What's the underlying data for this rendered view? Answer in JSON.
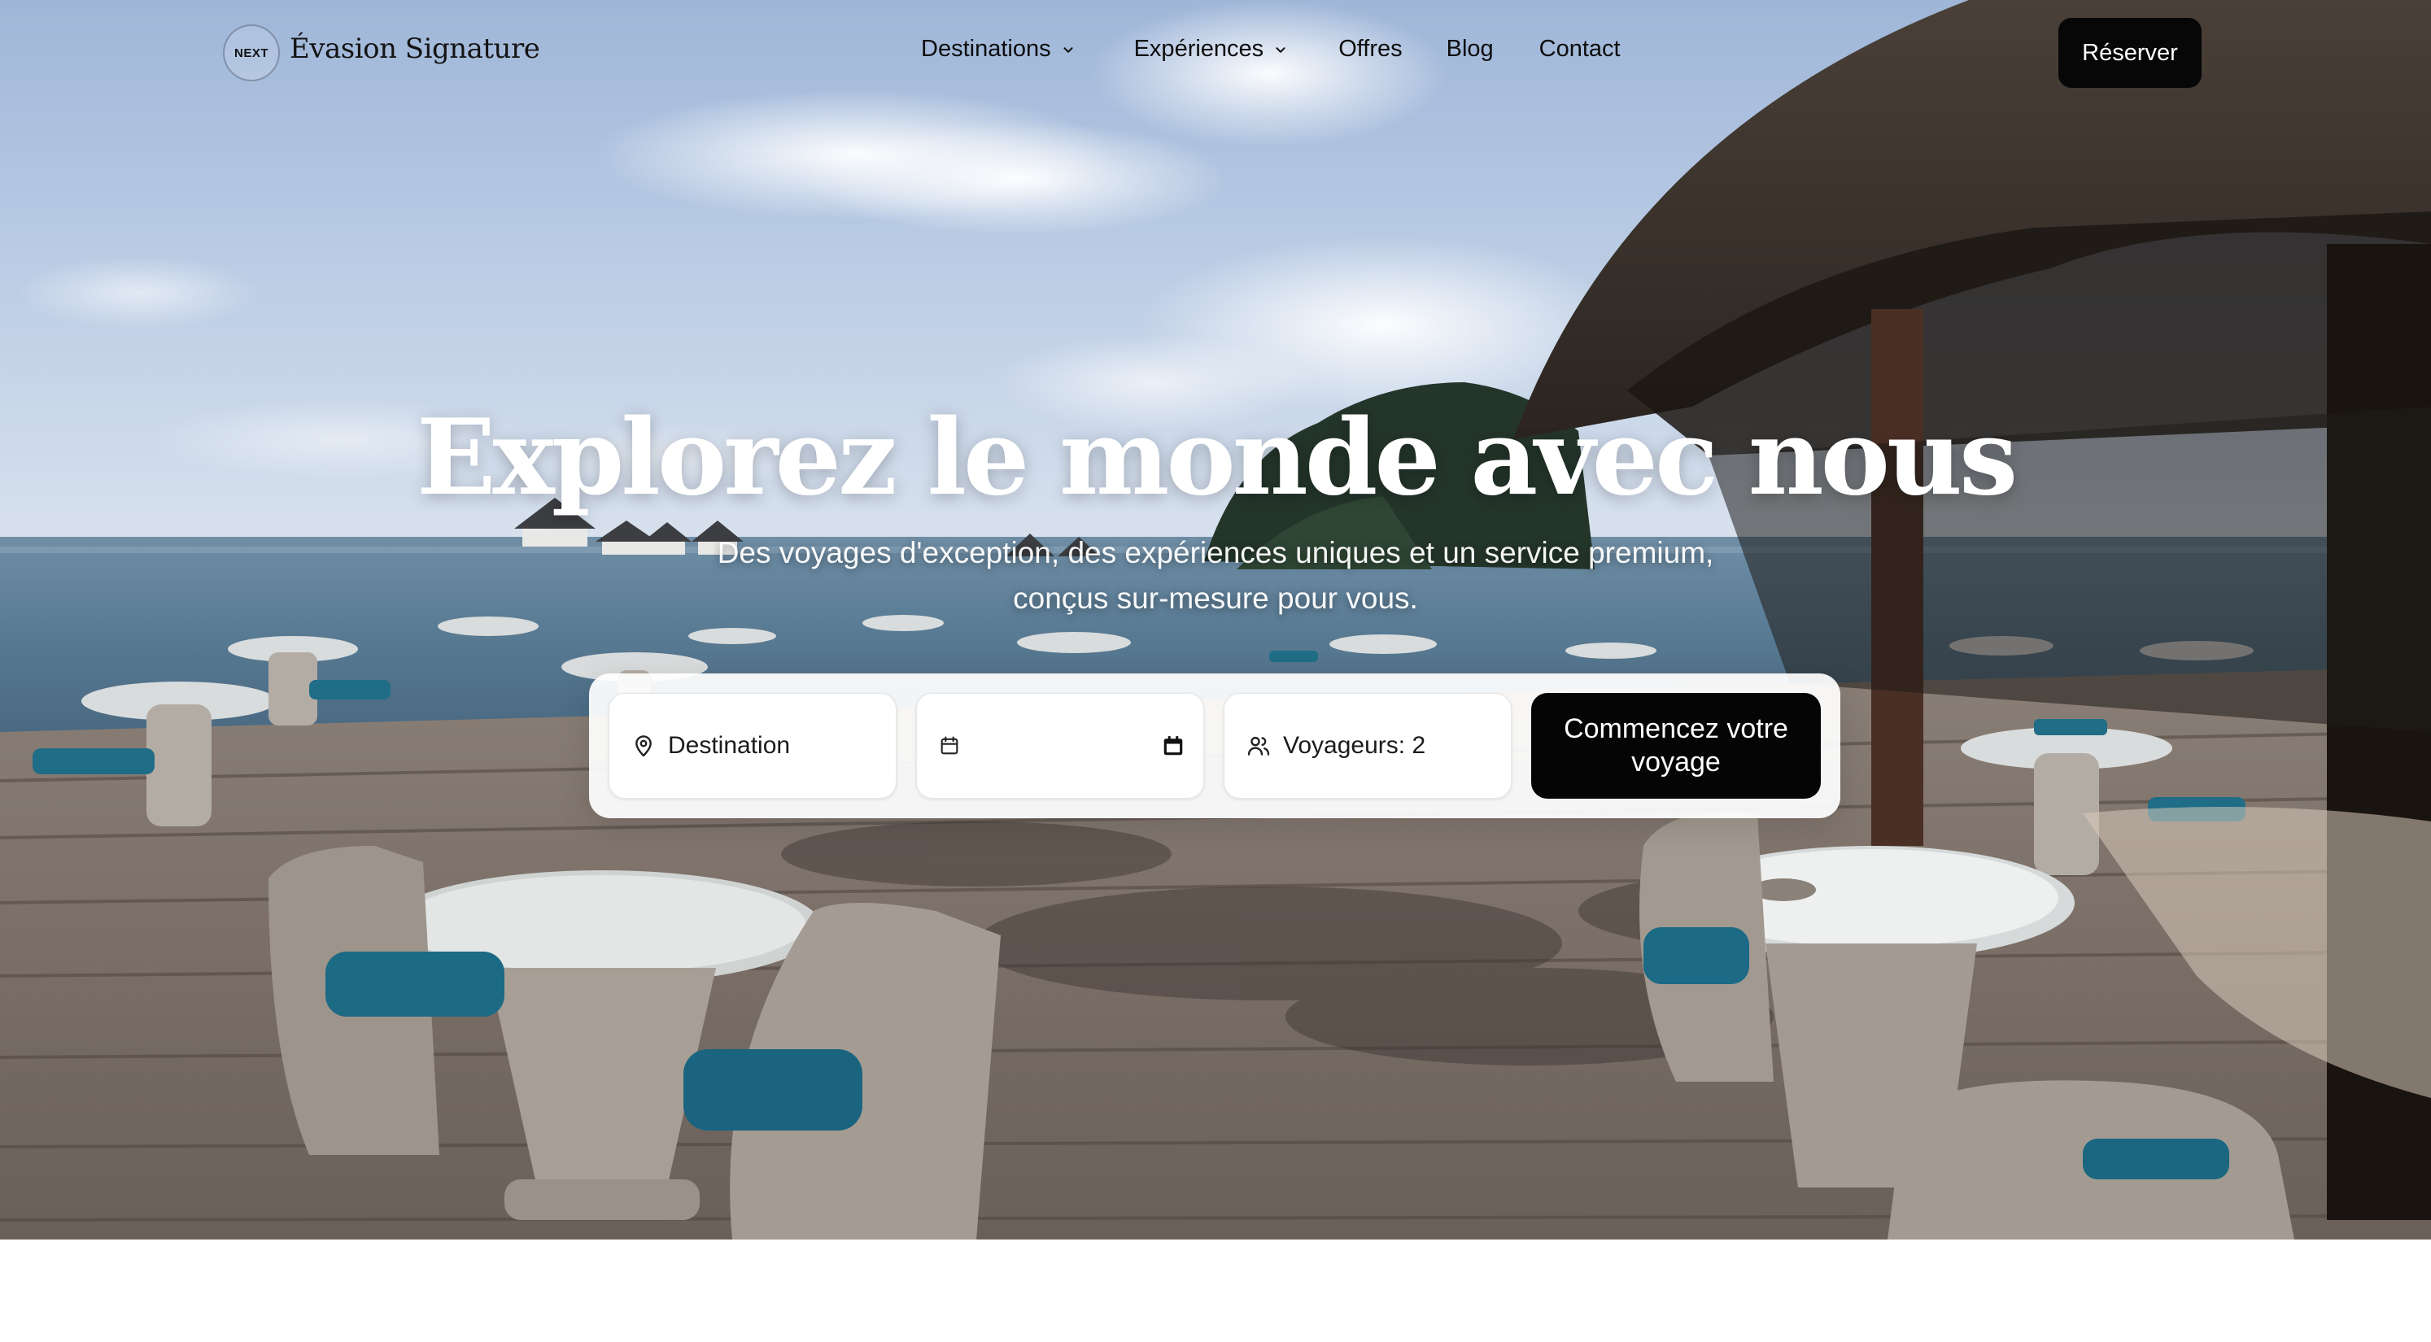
{
  "header": {
    "logo_text": "NEXT",
    "brand": "Évasion Signature",
    "nav": [
      {
        "label": "Destinations",
        "has_dropdown": true
      },
      {
        "label": "Expériences",
        "has_dropdown": true
      },
      {
        "label": "Offres",
        "has_dropdown": false
      },
      {
        "label": "Blog",
        "has_dropdown": false
      },
      {
        "label": "Contact",
        "has_dropdown": false
      }
    ],
    "cta": "Réserver"
  },
  "hero": {
    "title": "Explorez le monde avec nous",
    "subtitle_line1": "Des voyages d'exception, des expériences uniques et un service premium,",
    "subtitle_line2": "conçus sur-mesure pour vous.",
    "background": "tropical-overwater-deck-photo"
  },
  "search": {
    "destination_placeholder": "Destination",
    "date_value": "",
    "guests_value": "Voyageurs: 2",
    "submit": "Commencez votre voyage"
  },
  "icons": {
    "destination": "map-pin-icon",
    "date": "calendar-icon",
    "guests": "users-icon",
    "dropdown": "chevron-down-icon"
  },
  "colors": {
    "primary": "#070707",
    "text": "#0d0d0d",
    "panel": "#ffffff"
  }
}
